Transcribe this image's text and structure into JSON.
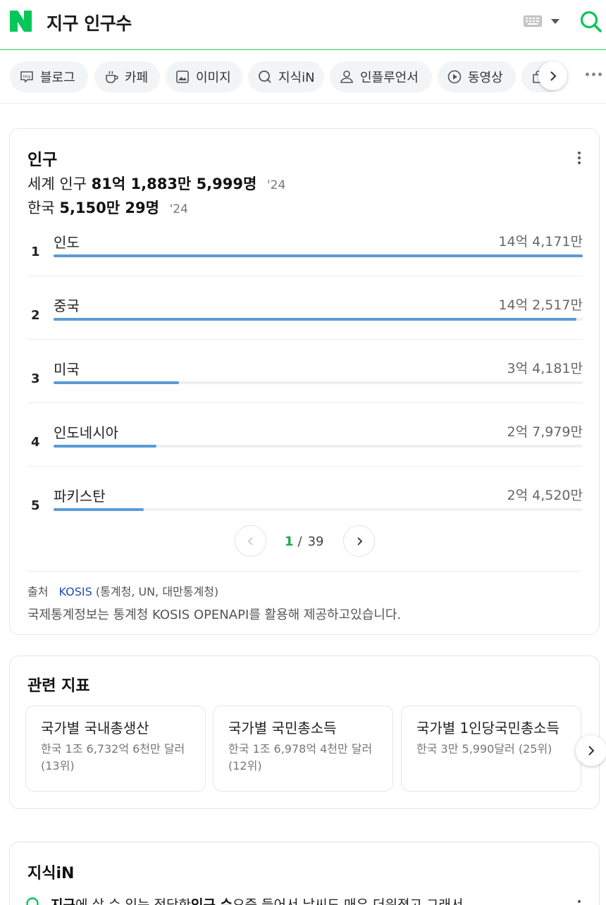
{
  "header": {
    "query": "지구 인구수",
    "brand_color": "#03c75a"
  },
  "tabs": [
    {
      "label": "블로그",
      "icon": "blog-icon"
    },
    {
      "label": "카페",
      "icon": "cafe-icon"
    },
    {
      "label": "이미지",
      "icon": "image-icon"
    },
    {
      "label": "지식iN",
      "icon": "kin-icon"
    },
    {
      "label": "인플루언서",
      "icon": "influencer-icon"
    },
    {
      "label": "동영상",
      "icon": "video-icon"
    },
    {
      "label": "",
      "icon": "shopping-icon"
    }
  ],
  "population": {
    "title": "인구",
    "world": {
      "label": "세계 인구",
      "value": "81억 1,883만 5,999명",
      "year": "'24"
    },
    "korea": {
      "label": "한국",
      "value": "5,150만 29명",
      "year": "'24"
    },
    "ranking": [
      {
        "rank": "1",
        "country": "인도",
        "value": "14억 4,171만",
        "ratio": 1.0
      },
      {
        "rank": "2",
        "country": "중국",
        "value": "14억 2,517만",
        "ratio": 0.988
      },
      {
        "rank": "3",
        "country": "미국",
        "value": "3억 4,181만",
        "ratio": 0.237
      },
      {
        "rank": "4",
        "country": "인도네시아",
        "value": "2억 7,979만",
        "ratio": 0.194
      },
      {
        "rank": "5",
        "country": "파키스탄",
        "value": "2억 4,520만",
        "ratio": 0.17
      }
    ],
    "bar_color": "#5b9bd5",
    "pager": {
      "current": "1",
      "separator": "/",
      "total": "39"
    },
    "source": {
      "label": "출처",
      "name": "KOSIS",
      "detail": "(통계청, UN, 대만통계청)"
    },
    "note": "국제통계정보는 통계청 KOSIS OPENAPI를 활용해 제공하고있습니다."
  },
  "related": {
    "title": "관련 지표",
    "items": [
      {
        "name": "국가별 국내총생산",
        "desc": "한국 1조 6,732억 6천만 달러 (13위)"
      },
      {
        "name": "국가별 국민총소득",
        "desc": "한국 1조 6,978억 4천만 달러 (12위)"
      },
      {
        "name": "국가별 1인당국민총소득",
        "desc": "한국 3만 5,990달러 (25위)"
      }
    ]
  },
  "kin": {
    "title": "지식iN",
    "q_prefix": "지구",
    "q_mid1": "에 살 수 있는 적당한 ",
    "q_bold": "인구 수",
    "q_rest": " 요즘 들어서 날씨도 매우 더워졌고 그래서"
  }
}
